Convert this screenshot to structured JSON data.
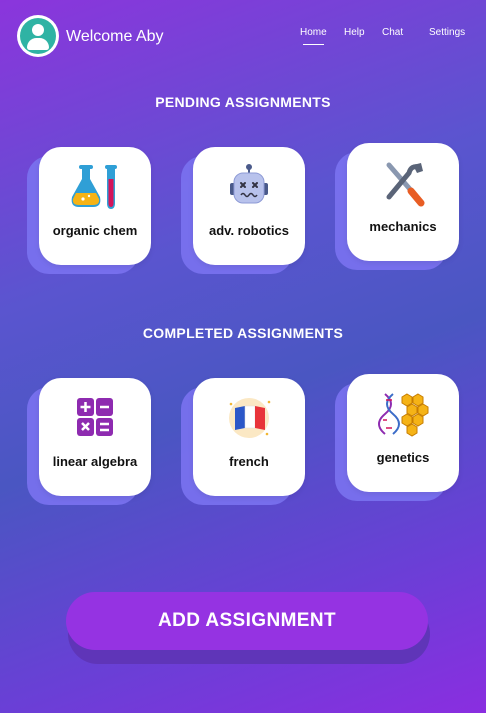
{
  "header": {
    "welcome": "Welcome Aby",
    "nav": [
      "Home",
      "Help",
      "Chat",
      "Settings"
    ]
  },
  "pending": {
    "title": "PENDING ASSIGNMENTS",
    "items": [
      {
        "label": "organic chem",
        "icon": "chemistry-flask-icon"
      },
      {
        "label": "adv. robotics",
        "icon": "robot-icon"
      },
      {
        "label": "mechanics",
        "icon": "wrench-screwdriver-icon"
      }
    ]
  },
  "completed": {
    "title": "COMPLETED  ASSIGNMENTS",
    "items": [
      {
        "label": "linear algebra",
        "icon": "calculator-icon"
      },
      {
        "label": "french",
        "icon": "french-flag-icon"
      },
      {
        "label": "genetics",
        "icon": "dna-icon"
      }
    ]
  },
  "add_button": "ADD ASSIGNMENT",
  "colors": {
    "accent": "#9533e2",
    "teal": "#2fb3a4",
    "card_shadow": "#7a72f0"
  }
}
